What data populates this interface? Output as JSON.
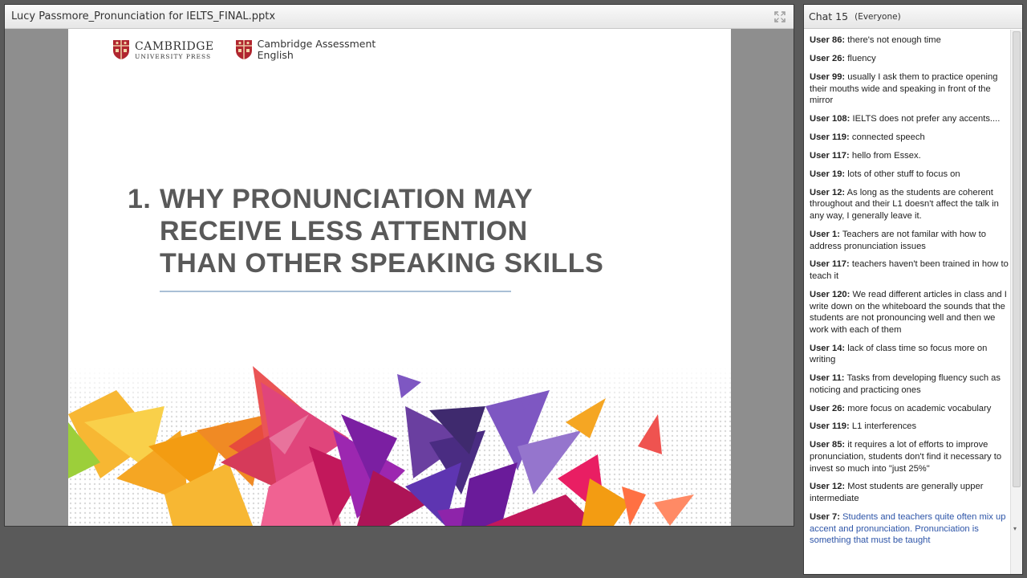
{
  "presentation": {
    "title": "Lucy Passmore_Pronunciation for IELTS_FINAL.pptx",
    "fullscreen_icon": "fullscreen-icon",
    "slide": {
      "logo1_main": "CAMBRIDGE",
      "logo1_sub": "UNIVERSITY PRESS",
      "logo2_main": "Cambridge Assessment",
      "logo2_sub": "English",
      "heading_number": "1.",
      "heading_lines": [
        "WHY PRONUNCIATION MAY",
        "RECEIVE LESS ATTENTION",
        "THAN OTHER SPEAKING SKILLS"
      ],
      "colors": {
        "heading": "#595959",
        "rule": "#a9bfd6"
      }
    }
  },
  "chat": {
    "title": "Chat 15",
    "audience": "(Everyone)",
    "messages": [
      {
        "user": "User 86:",
        "text": " there's not enough time"
      },
      {
        "user": "User 26:",
        "text": " fluency"
      },
      {
        "user": "User 99:",
        "text": " usually I ask them to practice opening their mouths wide and speaking in front of the mirror"
      },
      {
        "user": "User 108:",
        "text": " IELTS does not prefer any accents...."
      },
      {
        "user": "User 119:",
        "text": " connected speech"
      },
      {
        "user": "User 117:",
        "text": " hello from Essex."
      },
      {
        "user": "User 19:",
        "text": " lots of other stuff to focus on"
      },
      {
        "user": "User 12:",
        "text": " As long as the students are coherent throughout and their L1 doesn't affect the talk in any way, I generally leave it."
      },
      {
        "user": "User 1:",
        "text": " Teachers are not familar with how to address pronunciation issues"
      },
      {
        "user": "User 117:",
        "text": " teachers haven't been trained in how to teach it"
      },
      {
        "user": "User 120:",
        "text": " We read different articles in class and I write down on the whiteboard the sounds that the students are not  pronouncing well and then we work with each of them"
      },
      {
        "user": "User 14:",
        "text": " lack of class time so focus more on writing"
      },
      {
        "user": "User 11:",
        "text": " Tasks from developing fluency  such as noticing and practicing ones"
      },
      {
        "user": "User 26:",
        "text": " more focus on academic vocabulary"
      },
      {
        "user": "User 119:",
        "text": " L1 interferences"
      },
      {
        "user": "User 85:",
        "text": " it requires a lot of efforts to improve pronunciation, students don't find it necessary to invest so much into \"just 25%\""
      },
      {
        "user": "User 12:",
        "text": " Most students are generally upper intermediate"
      },
      {
        "user": "User 7:",
        "text": " Students and teachers quite often mix up accent and pronunciation. Pronunciation is something that must be taught",
        "highlight": true
      }
    ],
    "highlight_color": "#2e55a8"
  }
}
